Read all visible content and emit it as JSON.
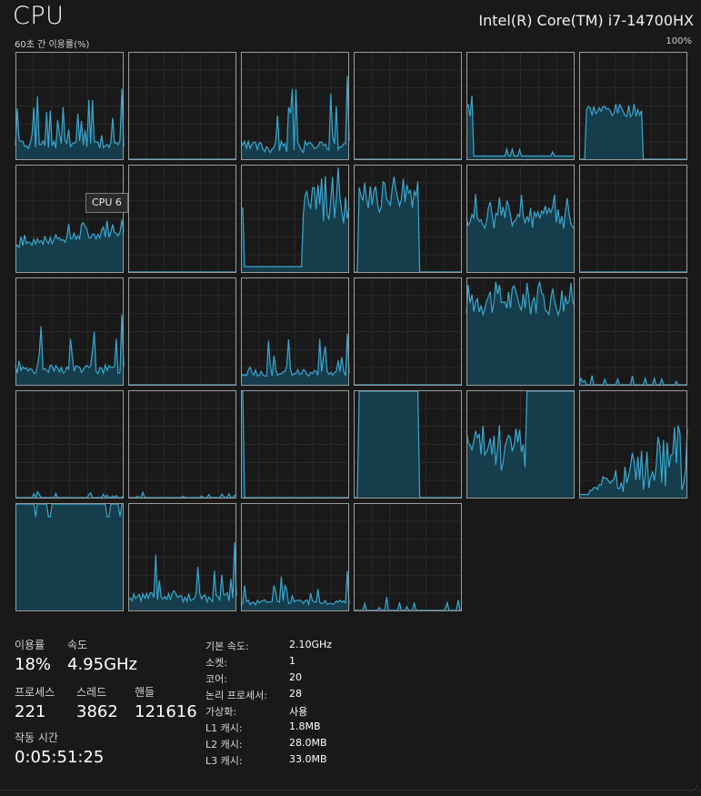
{
  "header": {
    "title": "CPU",
    "cpu_name": "Intel(R) Core(TM) i7-14700HX",
    "graph_caption": "60초 간 이용률(%)",
    "max_label": "100%"
  },
  "tooltip": "CPU 6",
  "colors": {
    "background": "#191919",
    "graph_line": "#3aa7cf",
    "graph_fill": "#153d4c",
    "border": "#9a9a9a",
    "gridline": "#2a2a2a"
  },
  "stats": {
    "usage_label": "이용률",
    "usage_value": "18%",
    "speed_label": "속도",
    "speed_value": "4.95GHz",
    "processes_label": "프로세스",
    "processes_value": "221",
    "threads_label": "스레드",
    "threads_value": "3862",
    "handles_label": "핸들",
    "handles_value": "121616",
    "uptime_label": "작동 시간",
    "uptime_value": "0:05:51:25"
  },
  "info": [
    {
      "label": "기본 속도:",
      "value": "2.10GHz"
    },
    {
      "label": "소켓:",
      "value": "1"
    },
    {
      "label": "코어:",
      "value": "20"
    },
    {
      "label": "논리 프로세서:",
      "value": "28"
    },
    {
      "label": "가상화:",
      "value": "사용"
    },
    {
      "label": "L1 캐시:",
      "value": "1.8MB"
    },
    {
      "label": "L2 캐시:",
      "value": "28.0MB"
    },
    {
      "label": "L3 캐시:",
      "value": "33.0MB"
    }
  ],
  "cores": [
    {
      "pattern": "spiky",
      "base": 10,
      "amp": 35,
      "seed": 1
    },
    {
      "pattern": "flat",
      "base": 0,
      "amp": 0,
      "seed": 2
    },
    {
      "pattern": "spiky",
      "base": 6,
      "amp": 45,
      "seed": 3
    },
    {
      "pattern": "flat",
      "base": 0,
      "amp": 0,
      "seed": 4
    },
    {
      "pattern": "early-burst",
      "base": 8,
      "amp": 35,
      "seed": 5
    },
    {
      "pattern": "plateau",
      "base": 40,
      "amp": 12,
      "start": 0.06,
      "end": 0.58,
      "seed": 6
    },
    {
      "pattern": "rising",
      "base": 22,
      "amp": 18,
      "seed": 7
    },
    {
      "pattern": "flat",
      "base": 0,
      "amp": 0,
      "seed": 8
    },
    {
      "pattern": "step-high",
      "base": 5,
      "amp": 60,
      "start": 0.56,
      "seed": 9
    },
    {
      "pattern": "burst",
      "base": 55,
      "amp": 35,
      "start": 0.05,
      "end": 0.6,
      "seed": 10
    },
    {
      "pattern": "busy",
      "base": 40,
      "amp": 35,
      "seed": 11
    },
    {
      "pattern": "flat",
      "base": 0,
      "amp": 0,
      "seed": 12
    },
    {
      "pattern": "spiky",
      "base": 10,
      "amp": 35,
      "seed": 13
    },
    {
      "pattern": "flat",
      "base": 0,
      "amp": 0,
      "seed": 14
    },
    {
      "pattern": "spiky",
      "base": 8,
      "amp": 25,
      "seed": 15
    },
    {
      "pattern": "flat",
      "base": 0,
      "amp": 0,
      "seed": 16
    },
    {
      "pattern": "busy-high",
      "base": 65,
      "amp": 32,
      "seed": 17
    },
    {
      "pattern": "sparse",
      "base": 0,
      "amp": 8,
      "seed": 18
    },
    {
      "pattern": "sparse",
      "base": 0,
      "amp": 5,
      "seed": 19
    },
    {
      "pattern": "sparse",
      "base": 0,
      "amp": 4,
      "seed": 20
    },
    {
      "pattern": "spike-start",
      "base": 0,
      "amp": 100,
      "seed": 21
    },
    {
      "pattern": "block",
      "base": 100,
      "amp": 0,
      "start": 0.05,
      "end": 0.6,
      "seed": 22
    },
    {
      "pattern": "mixed-full",
      "base": 25,
      "amp": 45,
      "start": 0.55,
      "seed": 23
    },
    {
      "pattern": "ramp",
      "base": 5,
      "amp": 55,
      "seed": 24
    },
    {
      "pattern": "full",
      "base": 100,
      "amp": 0,
      "seed": 25
    },
    {
      "pattern": "spiky",
      "base": 8,
      "amp": 35,
      "seed": 26
    },
    {
      "pattern": "spiky",
      "base": 5,
      "amp": 20,
      "seed": 27
    },
    {
      "pattern": "sparse",
      "base": 0,
      "amp": 12,
      "seed": 28
    }
  ]
}
